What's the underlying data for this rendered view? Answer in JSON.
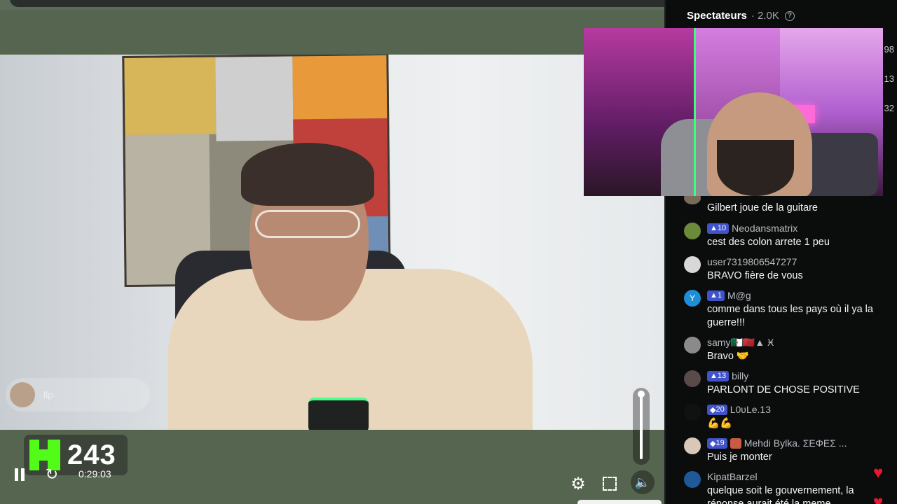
{
  "stream": {
    "viewer_count": "243",
    "elapsed": "0:29:03",
    "overlay_user": "llp"
  },
  "chat": {
    "header_title": "Spectateurs",
    "header_count": "· 2.0K",
    "side_numbers": [
      "98",
      "13",
      "32"
    ],
    "messages": [
      {
        "username": "",
        "badge": "",
        "text": "Gilbert joue de la guitare",
        "avatar_color": "#7a6a5a"
      },
      {
        "username": "Neodansmatrix",
        "badge": "10",
        "text": "cest des colon arrete 1 peu",
        "avatar_color": "#6b8a3a"
      },
      {
        "username": "user7319806547277",
        "badge": "",
        "text": "BRAVO fière de vous",
        "avatar_color": "#d8d8d8"
      },
      {
        "username": "M@g",
        "badge": "1",
        "text": "comme dans tous les pays où il ya la guerre!!!",
        "avatar_color": "#1e8fd6",
        "avatar_letter": "Y"
      },
      {
        "username": "samy🇩🇿🇲🇦▲ Ӿ",
        "badge": "",
        "text": "Bravo 🤝",
        "avatar_color": "#8a8a8a"
      },
      {
        "username": "billy",
        "badge": "13",
        "text": "PARLONT DE CHOSE POSITIVE",
        "avatar_color": "#5a4a4a"
      },
      {
        "username": "L0ʋLe.13",
        "badge": "20",
        "text": "💪💪",
        "avatar_color": "#111111"
      },
      {
        "username": "Mehdi Bylka. ΣΕΦΕΣ ...",
        "badge": "19",
        "text": "Puis je monter",
        "avatar_color": "#d9c8b8"
      },
      {
        "username": "KipatBarzel",
        "badge": "",
        "text": "quelque soit le gouvernement, la réponse aurait été la meme",
        "avatar_color": "#1e5a9a"
      }
    ]
  },
  "colors": {
    "kick_green": "#53fc18",
    "badge_blue": "#4053c9",
    "heart_red": "#e8182f"
  }
}
